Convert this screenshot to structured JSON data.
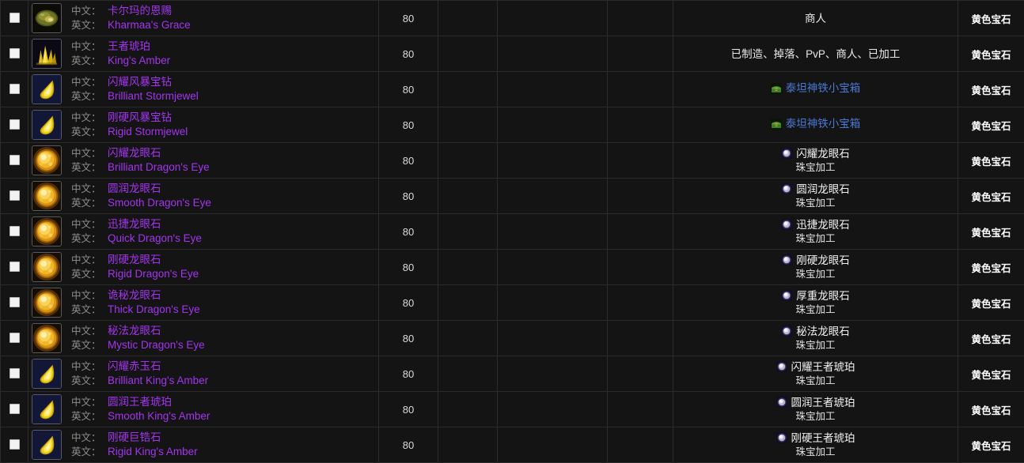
{
  "table": {
    "columns": [
      {
        "key": "checkbox",
        "label": ""
      },
      {
        "key": "name",
        "label": ""
      },
      {
        "key": "level",
        "label": ""
      },
      {
        "key": "c1",
        "label": ""
      },
      {
        "key": "c2",
        "label": ""
      },
      {
        "key": "c3",
        "label": ""
      },
      {
        "key": "source",
        "label": ""
      },
      {
        "key": "type",
        "label": ""
      }
    ],
    "labels": {
      "zh": "中文：",
      "en": "英文："
    },
    "colors": {
      "epic_purple": "#a335ee",
      "link_blue": "#4a79d4",
      "label_grey": "#8f8f8f",
      "text_white": "#ffffff",
      "row_bg": "#141414",
      "grid_line": "#2b2b2b"
    },
    "rows": [
      {
        "checked": false,
        "icon": "gem-olive-oval-icon",
        "name_zh": "卡尔玛的恩赐",
        "name_en": "Kharmaa's Grace",
        "level": "80",
        "c1": "",
        "c2": "",
        "c3": "",
        "source_kind": "plain",
        "source_text": "商人",
        "type": "黄色宝石"
      },
      {
        "checked": false,
        "icon": "gem-yellow-crystal-cluster-icon",
        "name_zh": "王者琥珀",
        "name_en": "King's Amber",
        "level": "80",
        "c1": "",
        "c2": "",
        "c3": "",
        "source_kind": "plain",
        "source_text": "已制造、掉落、PvP、商人、已加工",
        "type": "黄色宝石"
      },
      {
        "checked": false,
        "icon": "gem-yellow-teardrop-icon",
        "name_zh": "闪耀风暴宝钻",
        "name_en": "Brilliant Stormjewel",
        "level": "80",
        "c1": "",
        "c2": "",
        "c3": "",
        "source_kind": "link",
        "source_icon": "treasure-chest-icon",
        "source_link_text": "泰坦神铁小宝箱",
        "source_link_color": "blue",
        "source_sub": "",
        "type": "黄色宝石"
      },
      {
        "checked": false,
        "icon": "gem-yellow-teardrop-icon",
        "name_zh": "刚硬风暴宝钻",
        "name_en": "Rigid Stormjewel",
        "level": "80",
        "c1": "",
        "c2": "",
        "c3": "",
        "source_kind": "link",
        "source_icon": "treasure-chest-icon",
        "source_link_text": "泰坦神铁小宝箱",
        "source_link_color": "blue",
        "source_sub": "",
        "type": "黄色宝石"
      },
      {
        "checked": false,
        "icon": "gem-gold-sphere-icon",
        "name_zh": "闪耀龙眼石",
        "name_en": "Brilliant Dragon's Eye",
        "level": "80",
        "c1": "",
        "c2": "",
        "c3": "",
        "source_kind": "link",
        "source_icon": "gem-spell-icon",
        "source_link_text": "闪耀龙眼石",
        "source_link_color": "white",
        "source_sub": "珠宝加工",
        "type": "黄色宝石"
      },
      {
        "checked": false,
        "icon": "gem-gold-sphere-icon",
        "name_zh": "圆润龙眼石",
        "name_en": "Smooth Dragon's Eye",
        "level": "80",
        "c1": "",
        "c2": "",
        "c3": "",
        "source_kind": "link",
        "source_icon": "gem-spell-icon",
        "source_link_text": "圆润龙眼石",
        "source_link_color": "white",
        "source_sub": "珠宝加工",
        "type": "黄色宝石"
      },
      {
        "checked": false,
        "icon": "gem-gold-sphere-icon",
        "name_zh": "迅捷龙眼石",
        "name_en": "Quick Dragon's Eye",
        "level": "80",
        "c1": "",
        "c2": "",
        "c3": "",
        "source_kind": "link",
        "source_icon": "gem-spell-icon",
        "source_link_text": "迅捷龙眼石",
        "source_link_color": "white",
        "source_sub": "珠宝加工",
        "type": "黄色宝石"
      },
      {
        "checked": false,
        "icon": "gem-gold-sphere-icon",
        "name_zh": "刚硬龙眼石",
        "name_en": "Rigid Dragon's Eye",
        "level": "80",
        "c1": "",
        "c2": "",
        "c3": "",
        "source_kind": "link",
        "source_icon": "gem-spell-icon",
        "source_link_text": "刚硬龙眼石",
        "source_link_color": "white",
        "source_sub": "珠宝加工",
        "type": "黄色宝石"
      },
      {
        "checked": false,
        "icon": "gem-gold-sphere-icon",
        "name_zh": "诡秘龙眼石",
        "name_en": "Thick Dragon's Eye",
        "level": "80",
        "c1": "",
        "c2": "",
        "c3": "",
        "source_kind": "link",
        "source_icon": "gem-spell-icon",
        "source_link_text": "厚重龙眼石",
        "source_link_color": "white",
        "source_sub": "珠宝加工",
        "type": "黄色宝石"
      },
      {
        "checked": false,
        "icon": "gem-gold-sphere-icon",
        "name_zh": "秘法龙眼石",
        "name_en": "Mystic Dragon's Eye",
        "level": "80",
        "c1": "",
        "c2": "",
        "c3": "",
        "source_kind": "link",
        "source_icon": "gem-spell-icon",
        "source_link_text": "秘法龙眼石",
        "source_link_color": "white",
        "source_sub": "珠宝加工",
        "type": "黄色宝石"
      },
      {
        "checked": false,
        "icon": "gem-yellow-teardrop-icon",
        "name_zh": "闪耀赤玉石",
        "name_en": "Brilliant King's Amber",
        "level": "80",
        "c1": "",
        "c2": "",
        "c3": "",
        "source_kind": "link",
        "source_icon": "gem-spell-icon",
        "source_link_text": "闪耀王者琥珀",
        "source_link_color": "white",
        "source_sub": "珠宝加工",
        "type": "黄色宝石"
      },
      {
        "checked": false,
        "icon": "gem-yellow-teardrop-icon",
        "name_zh": "圆润王者琥珀",
        "name_en": "Smooth King's Amber",
        "level": "80",
        "c1": "",
        "c2": "",
        "c3": "",
        "source_kind": "link",
        "source_icon": "gem-spell-icon",
        "source_link_text": "圆润王者琥珀",
        "source_link_color": "white",
        "source_sub": "珠宝加工",
        "type": "黄色宝石"
      },
      {
        "checked": false,
        "icon": "gem-yellow-teardrop-icon",
        "name_zh": "刚硬巨锆石",
        "name_en": "Rigid King's Amber",
        "level": "80",
        "c1": "",
        "c2": "",
        "c3": "",
        "source_kind": "link",
        "source_icon": "gem-spell-icon",
        "source_link_text": "刚硬王者琥珀",
        "source_link_color": "white",
        "source_sub": "珠宝加工",
        "type": "黄色宝石"
      }
    ]
  }
}
